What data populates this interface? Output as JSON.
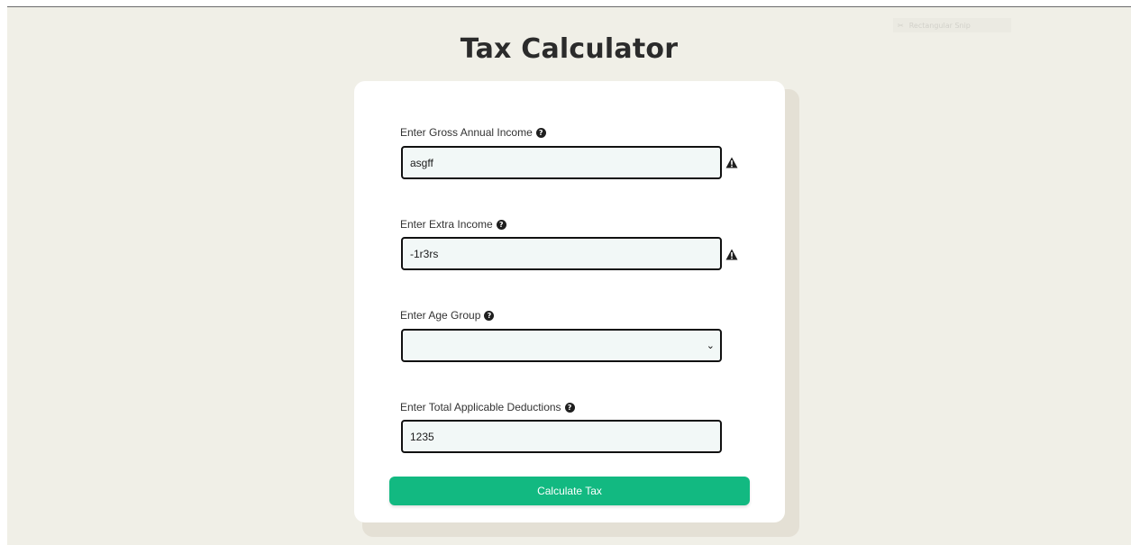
{
  "overlay": {
    "snip_label": "Rectangular Snip"
  },
  "page": {
    "title": "Tax Calculator"
  },
  "form": {
    "gross_income": {
      "label": "Enter Gross Annual Income",
      "value": "asgff",
      "has_warning": true
    },
    "extra_income": {
      "label": "Enter Extra Income",
      "value": "-1r3rs",
      "has_warning": true
    },
    "age_group": {
      "label": "Enter Age Group",
      "value": ""
    },
    "deductions": {
      "label": "Enter Total Applicable Deductions",
      "value": "1235"
    },
    "submit_label": "Calculate Tax"
  },
  "colors": {
    "background": "#f0efe7",
    "card": "#ffffff",
    "input_bg": "#f2f8f7",
    "button": "#12b981",
    "text": "#2b2b2b"
  },
  "icons": {
    "help": "question-circle-icon",
    "warning": "warning-triangle-icon",
    "select": "chevron-down-icon"
  }
}
